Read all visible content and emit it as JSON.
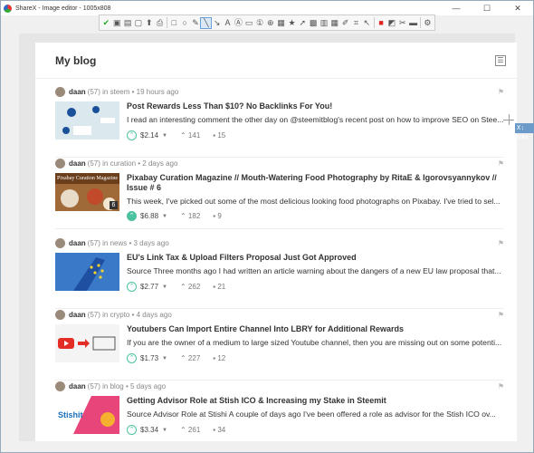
{
  "window": {
    "title": "ShareX - Image editor - 1005x808"
  },
  "blog": {
    "title": "My blog"
  },
  "cursor": {
    "coord_label": "X: 994"
  },
  "posts": [
    {
      "author": "daan",
      "rep": "(57)",
      "category_meta": "in steem • 19 hours ago",
      "title": "Post Rewards Less Than $10? No Backlinks For You!",
      "excerpt": "I read an interesting comment the other day on @steemitblog's recent post on how to improve SEO on Stee...",
      "payout": "$2.14",
      "votes": "141",
      "comments": "15"
    },
    {
      "author": "daan",
      "rep": "(57)",
      "category_meta": "in curation • 2 days ago",
      "title": "Pixabay Curation Magazine // Mouth-Watering Food Photography by RitaE & Igorovsyannykov // Issue # 6",
      "excerpt": "This week, I've picked out some of the most delicious looking food photographs on Pixabay. I've tried to sel...",
      "payout": "$6.88",
      "votes": "182",
      "comments": "9",
      "thumb_caption": "Pixabay Curation Magazine",
      "thumb_badge": "6"
    },
    {
      "author": "daan",
      "rep": "(57)",
      "category_meta": "in news • 3 days ago",
      "title": "EU's Link Tax & Upload Filters Proposal Just Got Approved",
      "excerpt": "Source Three months ago I had written an article warning about the dangers of a new EU law proposal that...",
      "payout": "$2.77",
      "votes": "262",
      "comments": "21"
    },
    {
      "author": "daan",
      "rep": "(57)",
      "category_meta": "in crypto • 4 days ago",
      "title": "Youtubers Can Import Entire Channel Into LBRY for Additional Rewards",
      "excerpt": "If you are the owner of a medium to large sized Youtube channel, then you are missing out on some potenti...",
      "payout": "$1.73",
      "votes": "227",
      "comments": "12"
    },
    {
      "author": "daan",
      "rep": "(57)",
      "category_meta": "in blog • 5 days ago",
      "title": "Getting Advisor Role at Stish ICO & Increasing my Stake in Steemit",
      "excerpt": "Source Advisor Role at Stishi A couple of days ago I've been offered a role as advisor for the Stish ICO ov...",
      "payout": "$3.34",
      "votes": "261",
      "comments": "34",
      "thumb_caption": "Stishit"
    }
  ]
}
